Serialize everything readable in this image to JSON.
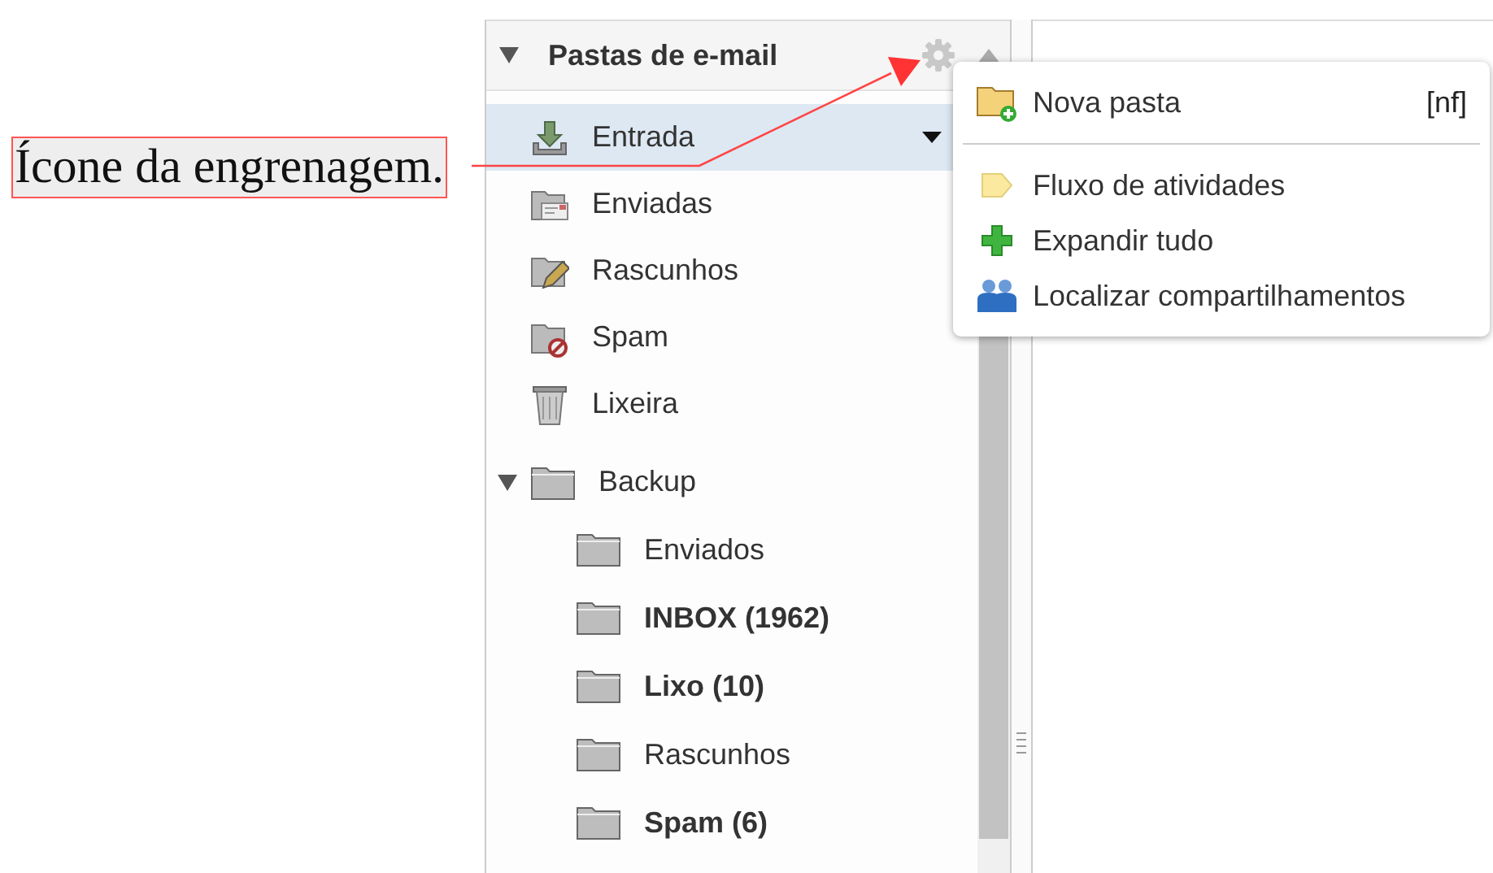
{
  "annotation": {
    "text": "Ícone da engrenagem."
  },
  "folder_panel": {
    "title": "Pastas de e-mail",
    "expanded": true,
    "folders": [
      {
        "name": "Entrada",
        "kind": "inbox",
        "selected": true,
        "unread": false
      },
      {
        "name": "Enviadas",
        "kind": "sent",
        "selected": false,
        "unread": false
      },
      {
        "name": "Rascunhos",
        "kind": "drafts",
        "selected": false,
        "unread": false
      },
      {
        "name": "Spam",
        "kind": "spam",
        "selected": false,
        "unread": false
      },
      {
        "name": "Lixeira",
        "kind": "trash",
        "selected": false,
        "unread": false
      },
      {
        "name": "Backup",
        "kind": "folder",
        "selected": false,
        "unread": false,
        "expanded": true,
        "children": [
          {
            "name": "Enviados",
            "kind": "folder",
            "selected": false,
            "unread": false
          },
          {
            "name": "INBOX (1962)",
            "kind": "folder",
            "selected": false,
            "unread": true
          },
          {
            "name": "Lixo (10)",
            "kind": "folder",
            "selected": false,
            "unread": true
          },
          {
            "name": "Rascunhos",
            "kind": "folder",
            "selected": false,
            "unread": false
          },
          {
            "name": "Spam (6)",
            "kind": "folder",
            "selected": false,
            "unread": true
          }
        ]
      }
    ]
  },
  "menu": {
    "groups": [
      [
        {
          "label": "Nova pasta",
          "kind": "new-folder",
          "shortcut": "[nf]"
        }
      ],
      [
        {
          "label": "Fluxo de atividades",
          "kind": "activity"
        },
        {
          "label": "Expandir tudo",
          "kind": "expand"
        },
        {
          "label": "Localizar compartilhamentos",
          "kind": "shares"
        }
      ]
    ]
  }
}
